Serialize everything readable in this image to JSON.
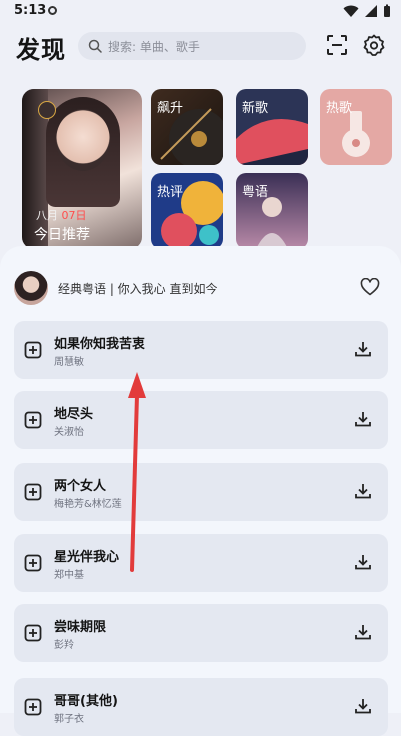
{
  "status": {
    "time": "5:13"
  },
  "header": {
    "title": "发现",
    "search_placeholder": "搜索: 单曲、歌手"
  },
  "cards": {
    "daily": {
      "month": "八月",
      "day": "07日",
      "label": "今日推荐"
    },
    "tiles": [
      {
        "label": "飙升"
      },
      {
        "label": "新歌"
      },
      {
        "label": "热歌"
      },
      {
        "label": "热评"
      },
      {
        "label": "粤语"
      }
    ]
  },
  "playlist": {
    "title": "经典粤语 | 你入我心 直到如今"
  },
  "songs": [
    {
      "name": "如果你知我苦衷",
      "artist": "周慧敏"
    },
    {
      "name": "地尽头",
      "artist": "关淑怡"
    },
    {
      "name": "两个女人",
      "artist": "梅艳芳&林忆莲"
    },
    {
      "name": "星光伴我心",
      "artist": "郑中基"
    },
    {
      "name": "尝味期限",
      "artist": "彭羚"
    },
    {
      "name": "哥哥(其他)",
      "artist": "郭子衣"
    }
  ],
  "colors": {
    "accent_red": "#e23b3b",
    "sheet": "#f3f6fc",
    "row": "#e4e8f1"
  }
}
